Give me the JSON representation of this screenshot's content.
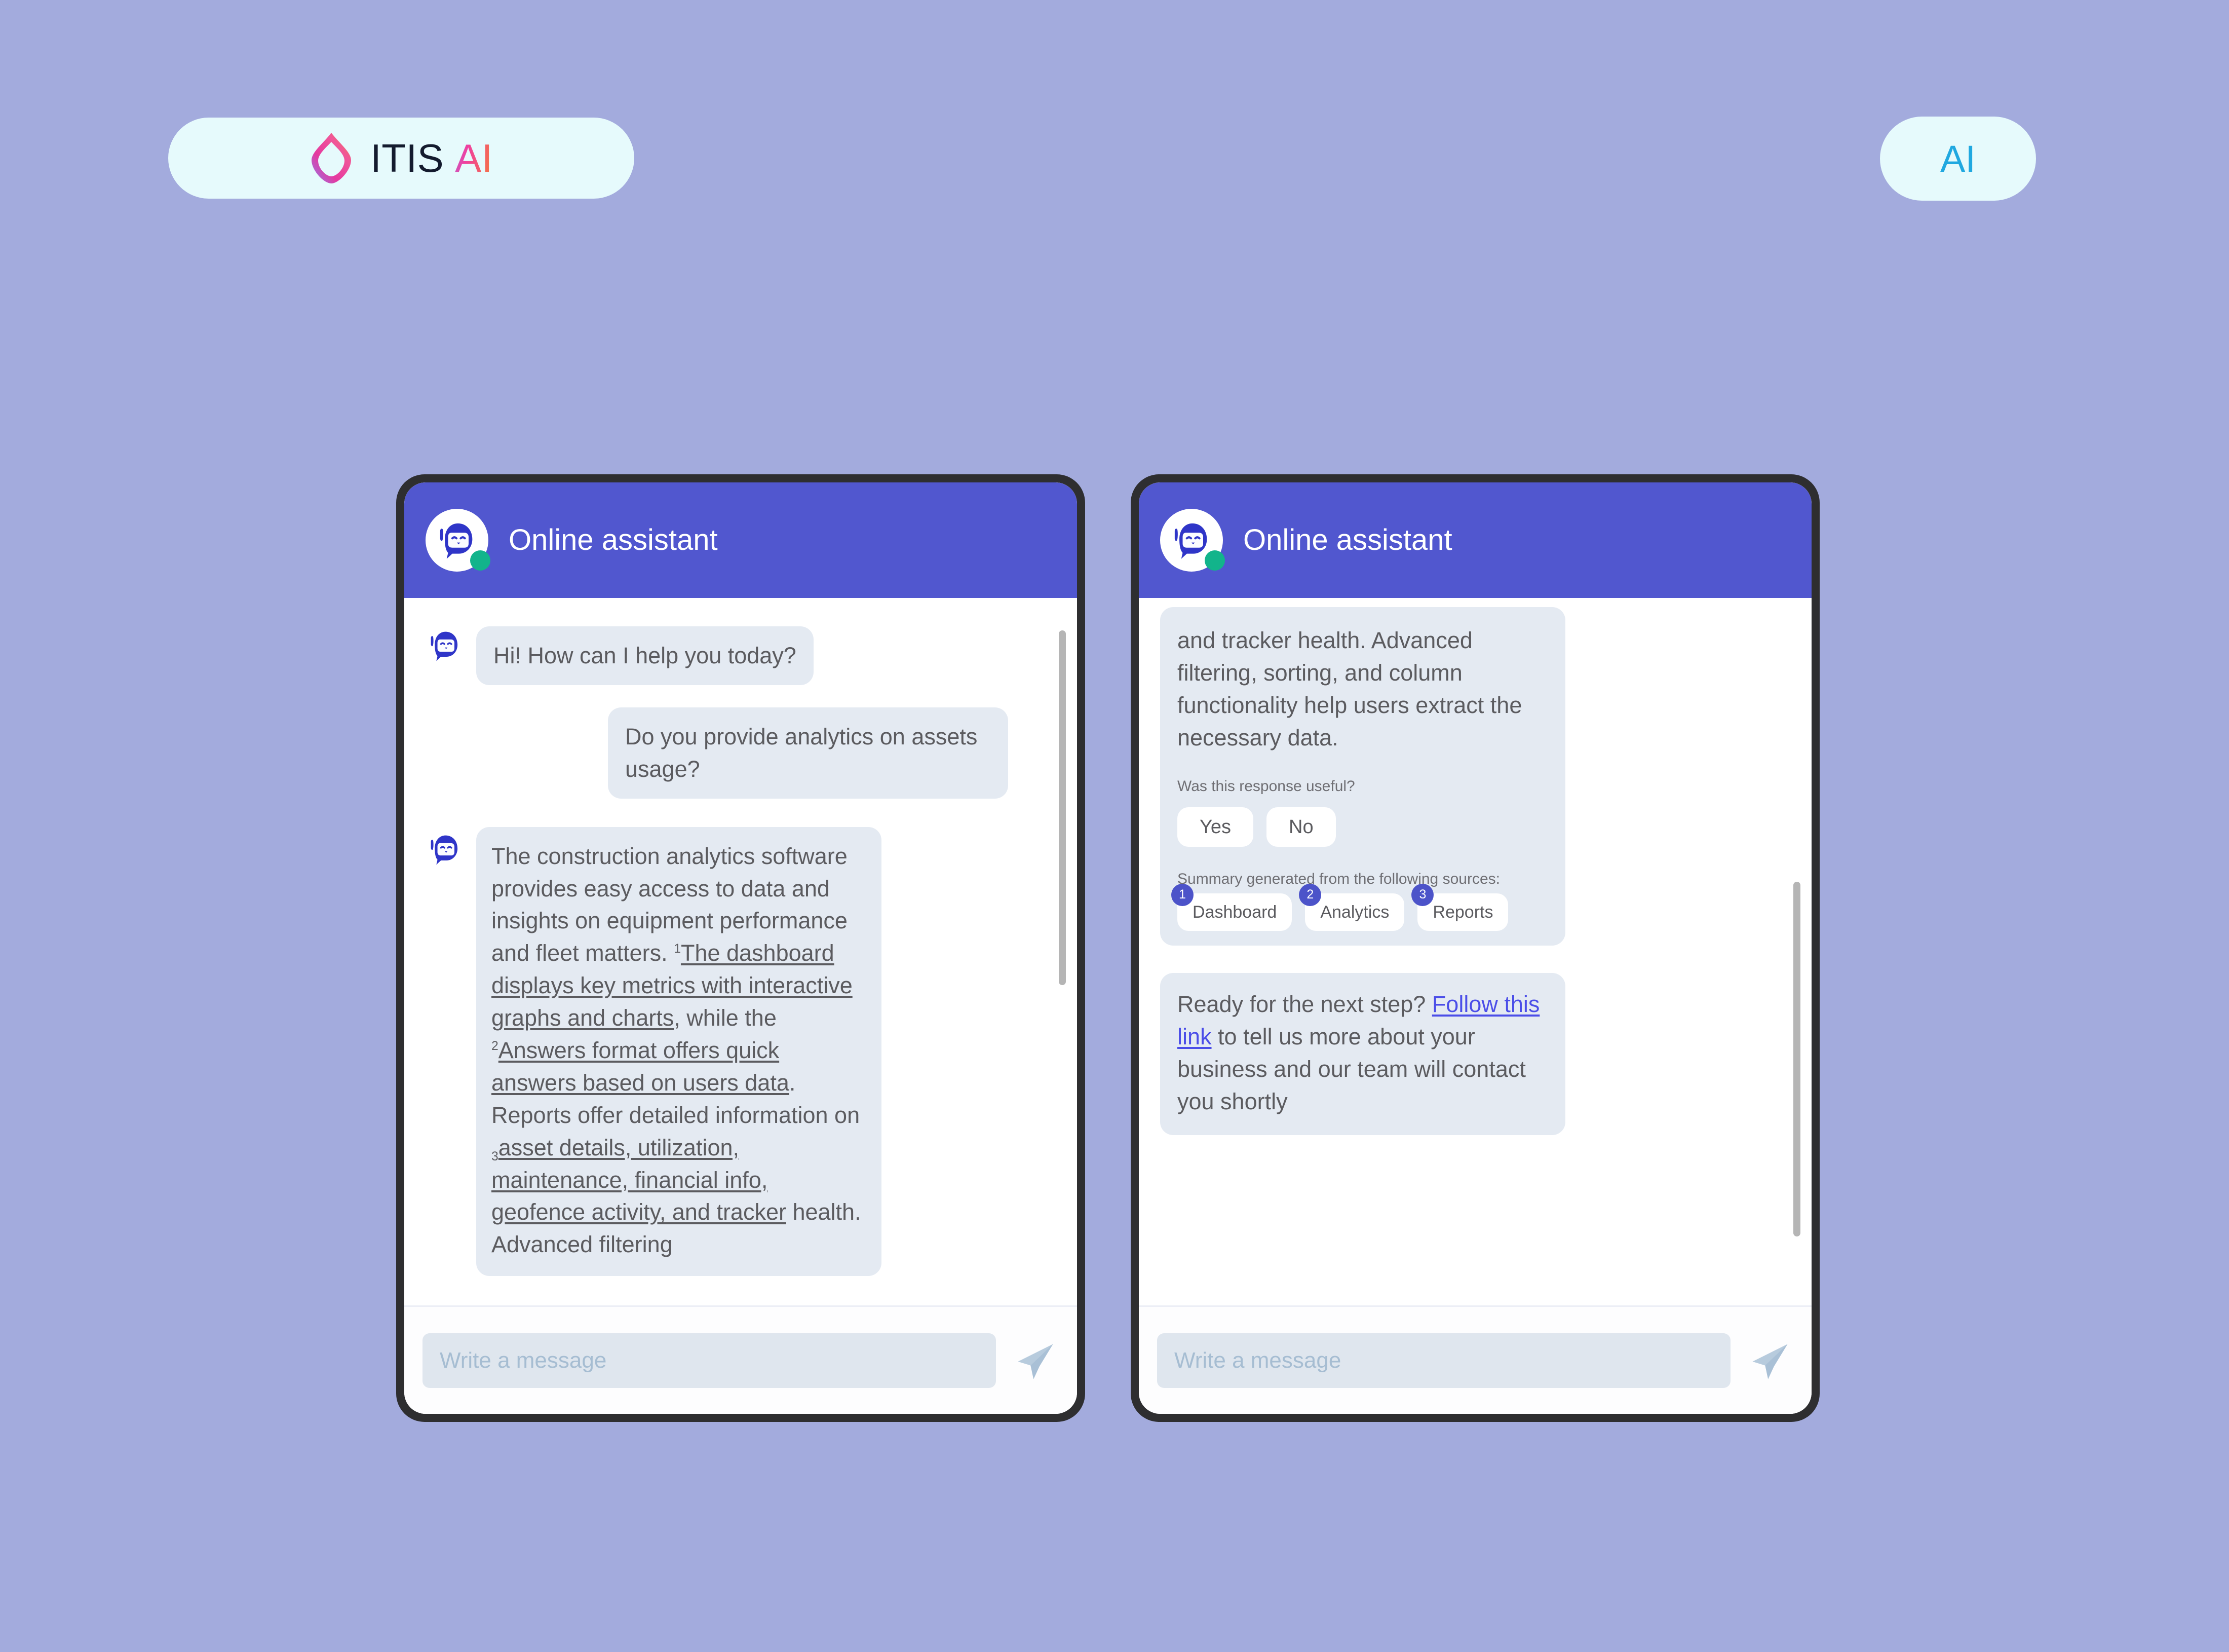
{
  "brand": {
    "logo_itis": "ITIS",
    "logo_ai": "AI",
    "badge_ai": "AI",
    "accent_indigo": "#5157cf",
    "accent_chip_blue": "#4c53c9",
    "background": "#a3abdd",
    "pill_background": "#e6fafc",
    "bubble_background": "#e4eaf2",
    "online_dot": "#12b48b",
    "link_blue": "#4b4ee8",
    "badge_ai_color": "#20a8e0"
  },
  "left_phone": {
    "header": {
      "title": "Online assistant",
      "avatar": "bot-avatar-icon",
      "status": "online"
    },
    "messages": [
      {
        "sender": "bot",
        "text": "Hi! How can I help you today?"
      },
      {
        "sender": "user",
        "text": "Do you provide analytics on assets usage?"
      },
      {
        "sender": "bot",
        "parts": [
          {
            "type": "plain",
            "text": "The construction analytics software provides easy access to data and insights on equipment performance and fleet matters. "
          },
          {
            "type": "sup",
            "text": "1"
          },
          {
            "type": "cited",
            "text": "The dashboard displays key metrics with interactive graphs and charts"
          },
          {
            "type": "plain",
            "text": ", while the "
          },
          {
            "type": "sup",
            "text": "2"
          },
          {
            "type": "cited",
            "text": "Answers format offers quick answers based on users data"
          },
          {
            "type": "plain",
            "text": ". Reports offer detailed information on "
          },
          {
            "type": "sub",
            "text": "3"
          },
          {
            "type": "cited",
            "text": "asset details, utilization, maintenance, financial info, geofence activity, and tracker"
          },
          {
            "type": "plain",
            "text": " health. Advanced filtering"
          }
        ]
      }
    ],
    "composer": {
      "placeholder": "Write a message",
      "value": "",
      "send_icon": "send-paper-plane-icon"
    }
  },
  "right_phone": {
    "header": {
      "title": "Online assistant",
      "avatar": "bot-avatar-icon",
      "status": "online"
    },
    "continued_message": {
      "text": "and tracker health. Advanced filtering, sorting, and column functionality help users extract the necessary data.",
      "feedback_question": "Was this response useful?",
      "feedback_buttons": [
        "Yes",
        "No"
      ],
      "sources_label": "Summary generated from the following sources:",
      "sources": [
        {
          "number": "1",
          "label": "Dashboard"
        },
        {
          "number": "2",
          "label": "Analytics"
        },
        {
          "number": "3",
          "label": "Reports"
        }
      ]
    },
    "next_step_message": {
      "lead": "Ready for the next step? ",
      "link": "Follow this link",
      "tail": " to tell us more about your business and our team will contact you shortly"
    },
    "composer": {
      "placeholder": "Write a message",
      "value": "",
      "send_icon": "send-paper-plane-icon"
    }
  }
}
